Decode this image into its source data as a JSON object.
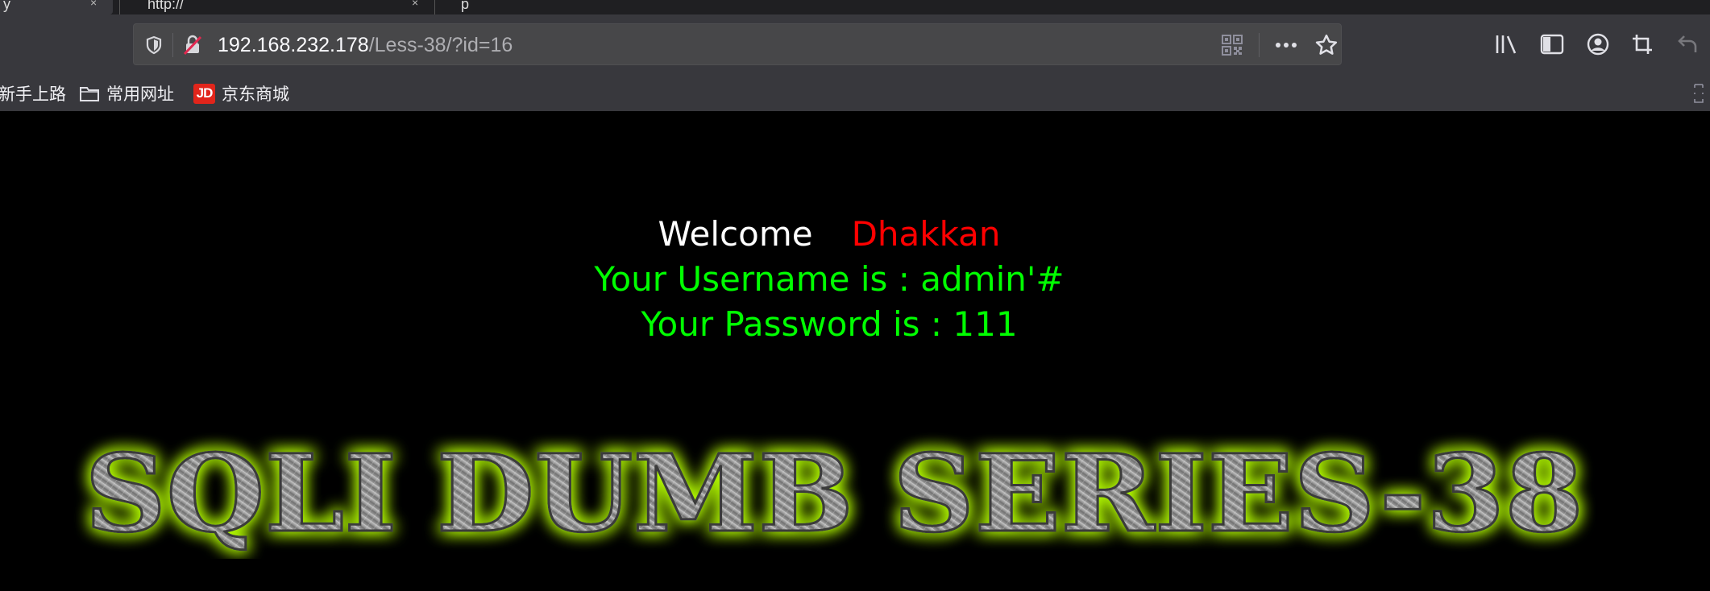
{
  "tabs": [
    {
      "label": "y",
      "close": "×"
    },
    {
      "label": "http://",
      "close": "×"
    },
    {
      "label": "p"
    }
  ],
  "urlbar": {
    "host": "192.168.232.178",
    "path": "/Less-38/?id=16"
  },
  "bookmarks": [
    {
      "label": "新手上路"
    },
    {
      "label": "常用网址",
      "icon": "folder-icon"
    },
    {
      "label": "京东商城",
      "icon": "jd-icon",
      "icon_text": "JD"
    }
  ],
  "page": {
    "welcome": "Welcome",
    "name": "Dhakkan",
    "username_line": "Your Username is : admin'#",
    "password_line": "Your Password is : 111",
    "banner_text": "SQLI DUMB SERIES-38"
  },
  "colors": {
    "welcome": "#ffffff",
    "name": "#ff0000",
    "result": "#00ff00",
    "banner_glow": "#b6ff00"
  }
}
